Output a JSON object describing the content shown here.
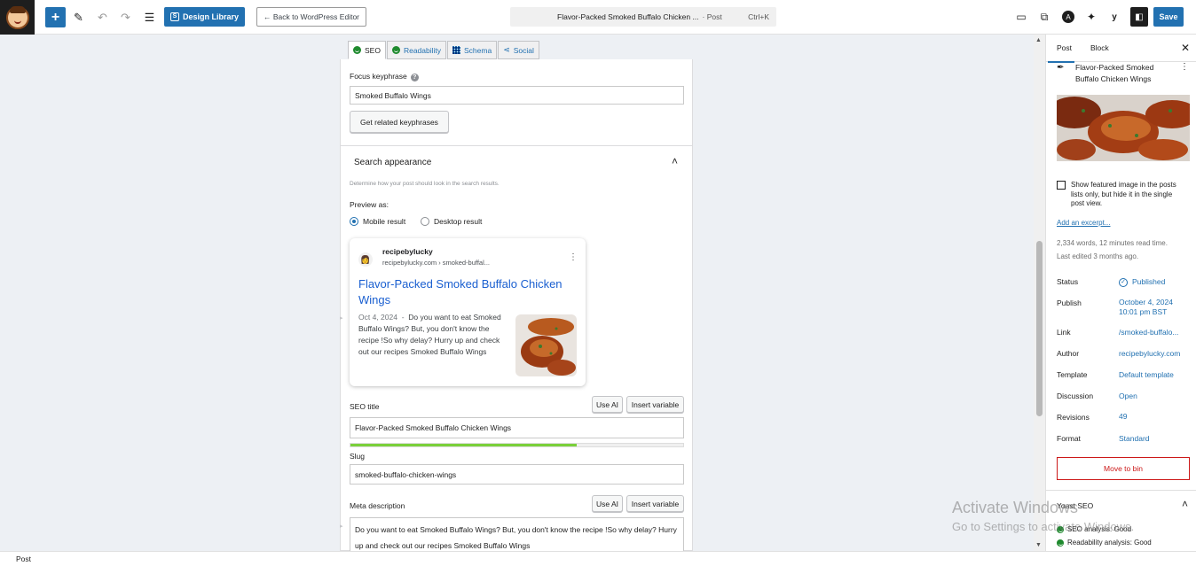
{
  "toolbar": {
    "design_library_label": "Design Library",
    "back_label": "← Back to WordPress Editor",
    "doc_title": "Flavor-Packed Smoked Buffalo Chicken ...",
    "doc_type": "· Post",
    "shortcut": "Ctrl+K",
    "save_label": "Save",
    "icons": [
      "add-block-icon",
      "pencil-icon",
      "undo-icon",
      "redo-icon",
      "list-view-icon",
      "view-desktop-icon",
      "external-link-icon",
      "astra-icon",
      "ai-sparkle-icon",
      "yoast-icon",
      "sidebar-toggle-icon"
    ]
  },
  "yoast": {
    "tabs": [
      {
        "label": "SEO",
        "icon": "smile-icon"
      },
      {
        "label": "Readability",
        "icon": "smile-icon"
      },
      {
        "label": "Schema",
        "icon": "grid-icon"
      },
      {
        "label": "Social",
        "icon": "share-icon"
      }
    ],
    "focus_keyphrase_label": "Focus keyphrase",
    "focus_keyphrase_value": "Smoked Buffalo Wings",
    "related_button": "Get related keyphrases",
    "search_appearance_label": "Search appearance",
    "search_appearance_help": "Determine how your post should look in the search results.",
    "preview_as_label": "Preview as:",
    "mobile_label": "Mobile result",
    "desktop_label": "Desktop result",
    "preview_mode": "mobile",
    "preview": {
      "site_name": "recipebylucky",
      "url": "recipebylucky.com › smoked-buffal...",
      "title": "Flavor-Packed Smoked Buffalo Chicken Wings",
      "date": "Oct 4, 2024",
      "separator": "-",
      "description": "Do you want to eat Smoked Buffalo Wings? But, you don't know the recipe !So why delay? Hurry up and check out our recipes Smoked Buffalo Wings"
    },
    "seo_title_label": "SEO title",
    "use_ai_label": "Use AI",
    "insert_variable_label": "Insert variable",
    "seo_title_value": "Flavor-Packed Smoked Buffalo Chicken Wings",
    "seo_title_progress": 0.68,
    "slug_label": "Slug",
    "slug_value": "smoked-buffalo-chicken-wings",
    "meta_description_label": "Meta description",
    "meta_description_value": "Do you want to eat Smoked Buffalo Wings? But, you don't know the recipe !So why delay? Hurry up and check out our recipes Smoked Buffalo Wings",
    "colors": {
      "link": "#1a5fd0",
      "good": "#1f8a2e",
      "progress": "#7ad03a"
    }
  },
  "sidebar": {
    "tab_post": "Post",
    "tab_block": "Block",
    "post_title": "Flavor-Packed Smoked Buffalo Chicken Wings",
    "featured_checkbox_label": "Show featured image in the posts lists only, but hide it in the single post view.",
    "excerpt_link": "Add an excerpt...",
    "word_count": "2,334 words, 12 minutes read time.",
    "last_edited": "Last edited 3 months ago.",
    "rows": [
      {
        "label": "Status",
        "value": "Published"
      },
      {
        "label": "Publish",
        "value": "October 4, 2024",
        "value2": "10:01 pm BST"
      },
      {
        "label": "Link",
        "value": "/smoked-buffalo..."
      },
      {
        "label": "Author",
        "value": "recipebylucky.com"
      },
      {
        "label": "Template",
        "value": "Default template"
      },
      {
        "label": "Discussion",
        "value": "Open"
      },
      {
        "label": "Revisions",
        "value": "49"
      },
      {
        "label": "Format",
        "value": "Standard"
      }
    ],
    "move_to_bin": "Move to bin",
    "yoast_label": "Yoast SEO",
    "seo_analysis": "SEO analysis: Good",
    "readability_analysis": "Readability analysis: Good"
  },
  "statusbar": {
    "label": "Post"
  },
  "watermark": {
    "line1": "Activate Windows",
    "line2": "Go to Settings to activate Windows."
  }
}
